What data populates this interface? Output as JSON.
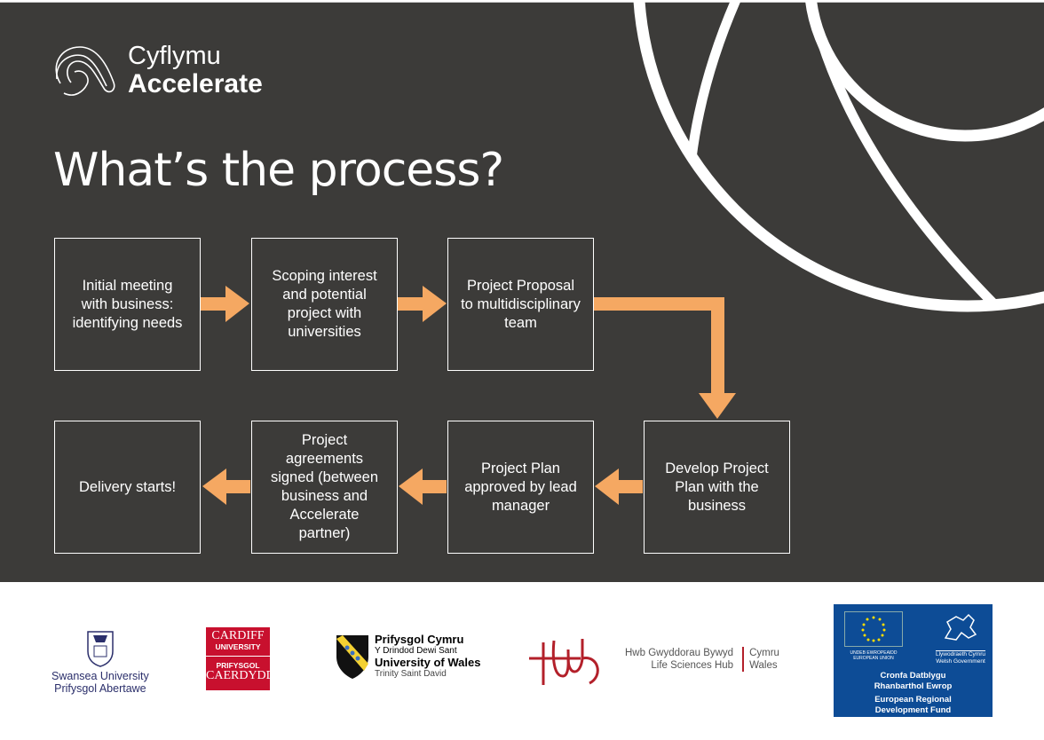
{
  "brand": {
    "line1": "Cyflymu",
    "line2": "Accelerate"
  },
  "title": "What’s the process?",
  "colors": {
    "background": "#3c3b39",
    "arrow": "#f5a862",
    "box_border": "#ffffff"
  },
  "steps": [
    {
      "label": "Initial meeting with business: identifying needs"
    },
    {
      "label": "Scoping interest and potential project with universities"
    },
    {
      "label": "Project Proposal to multidisciplinary team"
    },
    {
      "label": "Develop Project Plan with the business"
    },
    {
      "label": "Project Plan approved by lead manager"
    },
    {
      "label": "Project agreements signed (between business and Accelerate partner)"
    },
    {
      "label": "Delivery starts!"
    }
  ],
  "footer": {
    "swansea": {
      "line1": "Swansea University",
      "line2": "Prifysgol Abertawe"
    },
    "cardiff": {
      "line1": "CARDIFF",
      "line2": "UNIVERSITY",
      "line3": "PRIFYSGOL",
      "line4": "CAERDYDD"
    },
    "uwtsd": {
      "line1": "Prifysgol Cymru",
      "line2": "Y Drindod Dewi Sant",
      "line3": "University of Wales",
      "line4": "Trinity Saint David"
    },
    "hub": {
      "line1": "Hwb Gwyddorau Bywyd",
      "line2": "Life Sciences Hub",
      "line3": "Cymru",
      "line4": "Wales"
    },
    "erdf": {
      "eu1": "UNDEB EWROPEAIDD",
      "eu2": "EUROPEAN UNION",
      "wg1": "Llywodraeth Cymru",
      "wg2": "Welsh Government",
      "l1": "Cronfa Datblygu",
      "l2": "Rhanbarthol Ewrop",
      "l3": "European Regional",
      "l4": "Development Fund"
    }
  }
}
